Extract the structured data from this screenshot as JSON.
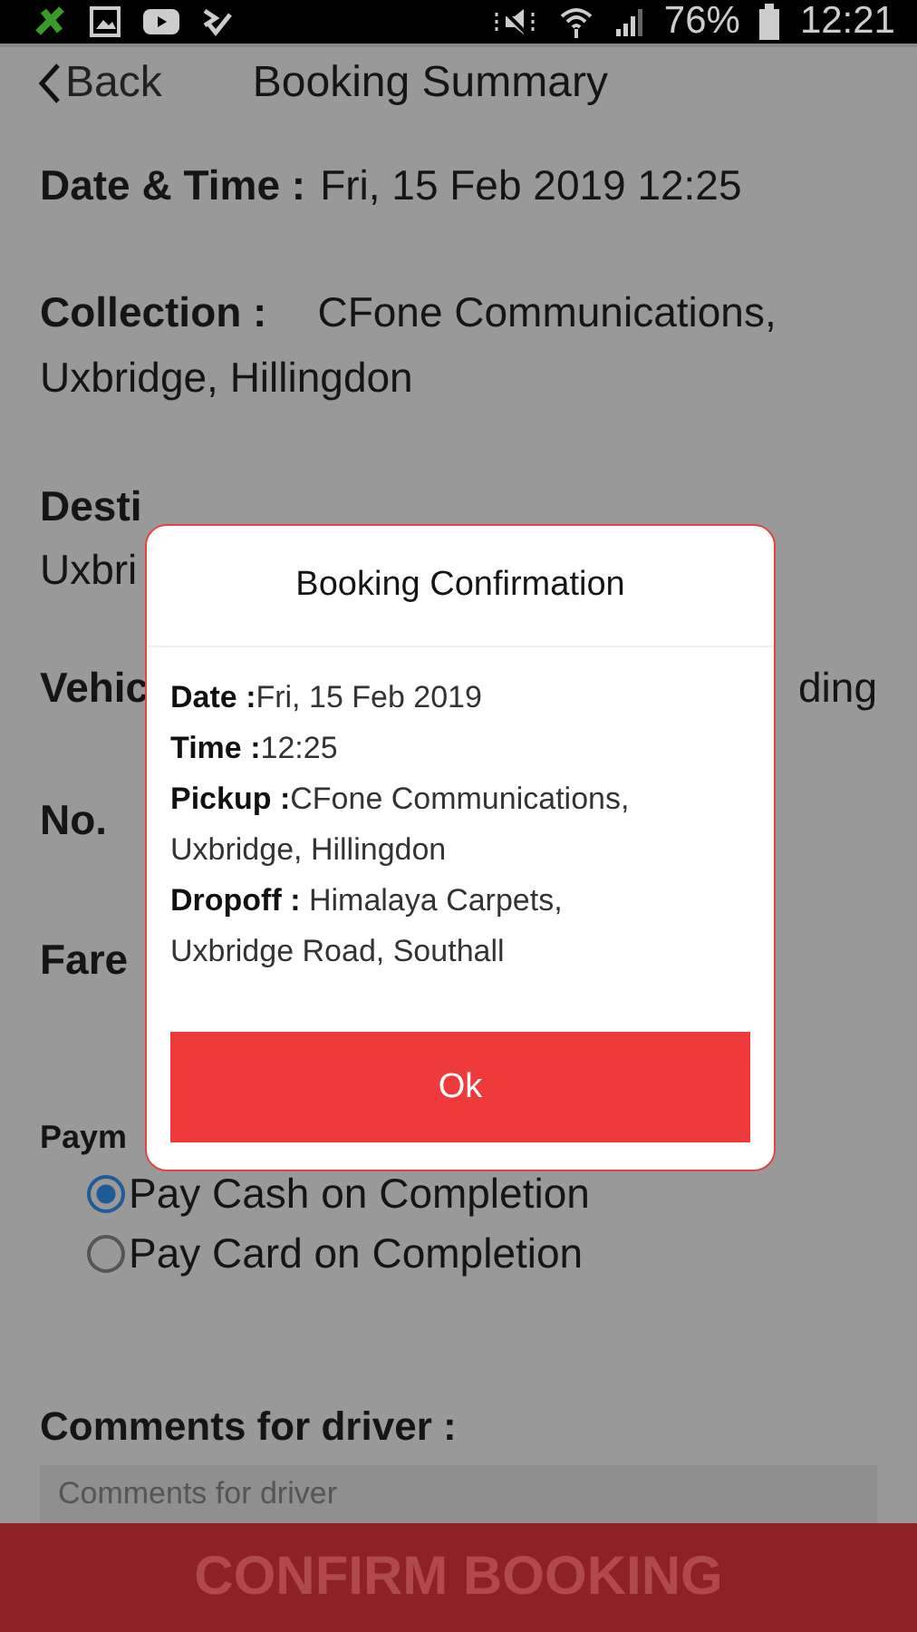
{
  "status_bar": {
    "battery": "76%",
    "time": "12:21"
  },
  "header": {
    "back": "Back",
    "title": "Booking Summary"
  },
  "summary": {
    "date_label": "Date & Time :",
    "date_value": "Fri, 15 Feb 2019 12:25",
    "collection_label": "Collection :",
    "collection_value": "CFone Communications, Uxbridge, Hillingdon",
    "destination_label": "Desti",
    "destination_value": "Uxbri",
    "vehicle_label": "Vehic",
    "vehicle_value": "ding",
    "passengers_label": "No.",
    "fare_label": "Fare"
  },
  "payment": {
    "label": "Paym",
    "options": [
      {
        "label": "Pay Cash on Completion",
        "selected": true
      },
      {
        "label": "Pay Card on Completion",
        "selected": false
      }
    ]
  },
  "comments": {
    "label": "Comments for driver :",
    "placeholder": "Comments for driver"
  },
  "confirm_button": "CONFIRM BOOKING",
  "dialog": {
    "title": "Booking Confirmation",
    "lines": [
      {
        "label": "Date :",
        "value": "Fri, 15 Feb 2019"
      },
      {
        "label": "Time :",
        "value": "12:25"
      },
      {
        "label": "Pickup :",
        "value": "CFone Communications, Uxbridge, Hillingdon"
      },
      {
        "label": "Dropoff :",
        "value": " Himalaya Carpets, Uxbridge Road, Southall"
      }
    ],
    "button": "Ok"
  }
}
